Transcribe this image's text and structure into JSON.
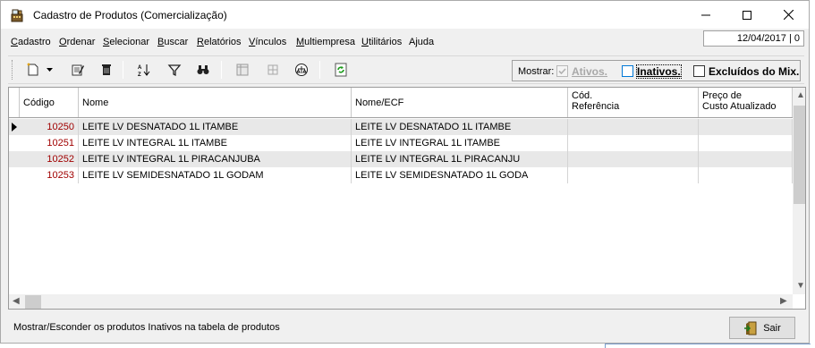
{
  "window": {
    "title": "Cadastro de Produtos (Comercialização)",
    "icon": "cash-register-icon"
  },
  "menu": {
    "items": [
      {
        "label": "Cadastro",
        "mnemonic": "C"
      },
      {
        "label": "Ordenar",
        "mnemonic": "O"
      },
      {
        "label": "Selecionar",
        "mnemonic": "S"
      },
      {
        "label": "Buscar",
        "mnemonic": "B"
      },
      {
        "label": "Relatórios",
        "mnemonic": "R"
      },
      {
        "label": "Vínculos",
        "mnemonic": "V"
      },
      {
        "label": "Multiempresa",
        "mnemonic": "M"
      },
      {
        "label": "Utilitários",
        "mnemonic": "U"
      },
      {
        "label": "Ajuda",
        "mnemonic": ""
      }
    ],
    "date_field": "12/04/2017 | 0"
  },
  "toolbar": {
    "icons": [
      "new-icon",
      "dropdown-arrow-icon",
      "edit-icon",
      "delete-icon",
      "sort-icon",
      "filter-icon",
      "binoculars-search-icon",
      "columns-icon",
      "settings-icon",
      "scale-icon",
      "refresh-icon"
    ],
    "filter": {
      "label": "Mostrar:",
      "ativos": {
        "label": "Ativos.",
        "checked": true,
        "enabled": false
      },
      "inativos": {
        "label": "Inativos.",
        "checked": false,
        "enabled": true
      },
      "excluidos": {
        "label": "Excluídos do Mix.",
        "checked": false,
        "enabled": true
      }
    }
  },
  "table": {
    "columns": [
      {
        "label": "Código"
      },
      {
        "label": "Nome"
      },
      {
        "label": "Nome/ECF"
      },
      {
        "label": "Cód.\nReferência"
      },
      {
        "label": "Preço de\nCusto Atualizado"
      }
    ],
    "rows": [
      {
        "codigo": "10250",
        "nome": "LEITE LV DESNATADO 1L ITAMBE",
        "nome_ecf": "LEITE LV DESNATADO 1L ITAMBE",
        "cod_ref": "",
        "preco": "",
        "selected": true
      },
      {
        "codigo": "10251",
        "nome": "LEITE LV INTEGRAL 1L ITAMBE",
        "nome_ecf": "LEITE LV INTEGRAL 1L ITAMBE",
        "cod_ref": "",
        "preco": "",
        "selected": false
      },
      {
        "codigo": "10252",
        "nome": "LEITE LV INTEGRAL 1L PIRACANJUBA",
        "nome_ecf": "LEITE LV INTEGRAL 1L PIRACANJU",
        "cod_ref": "",
        "preco": "",
        "selected": false
      },
      {
        "codigo": "10253",
        "nome": "LEITE LV SEMIDESNATADO 1L GODAM",
        "nome_ecf": "LEITE LV SEMIDESNATADO 1L GODA",
        "cod_ref": "",
        "preco": "",
        "selected": false
      }
    ]
  },
  "status": {
    "text": "Mostrar/Esconder os produtos Inativos na tabela de produtos",
    "exit_label": "Sair"
  },
  "colors": {
    "code_text": "#a00000",
    "alt_row": "#e8e8e8",
    "focus_check": "#0078d7"
  }
}
